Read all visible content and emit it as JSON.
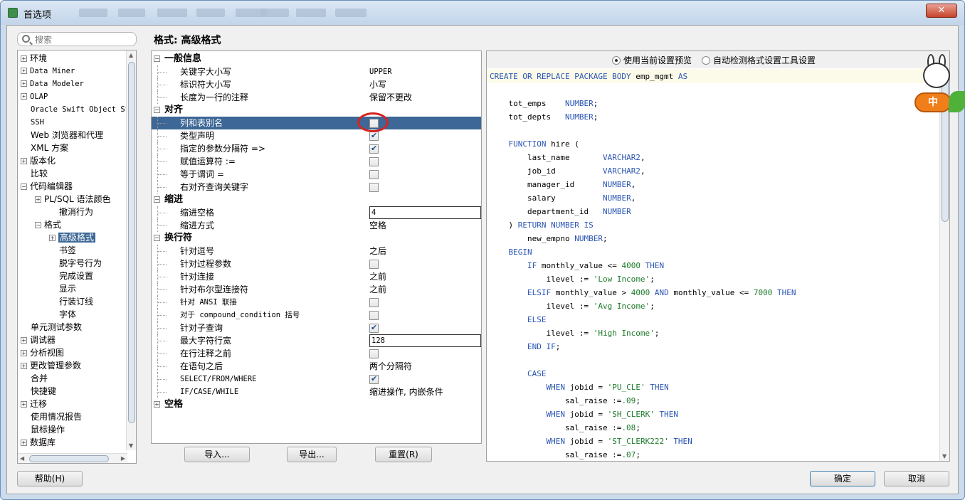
{
  "window": {
    "title": "首选项",
    "close": "✕"
  },
  "search": {
    "placeholder": "搜索"
  },
  "sidebar": {
    "items": [
      {
        "label": "环境",
        "exp": "+"
      },
      {
        "label": "Data Miner",
        "exp": "+",
        "mono": true
      },
      {
        "label": "Data Modeler",
        "exp": "+",
        "mono": true
      },
      {
        "label": "OLAP",
        "exp": "+",
        "mono": true
      },
      {
        "label": "Oracle Swift Object St",
        "mono": true
      },
      {
        "label": "SSH",
        "mono": true
      },
      {
        "label": "Web 浏览器和代理"
      },
      {
        "label": "XML 方案"
      },
      {
        "label": "版本化",
        "exp": "+"
      },
      {
        "label": "比较"
      },
      {
        "label": "代码编辑器",
        "exp": "−"
      },
      {
        "label": "PL/SQL 语法颜色",
        "exp": "+"
      },
      {
        "label": "撤消行为"
      },
      {
        "label": "格式",
        "exp": "−"
      },
      {
        "label": "高级格式",
        "exp": "+",
        "selected": true
      },
      {
        "label": "书签"
      },
      {
        "label": "脱字号行为"
      },
      {
        "label": "完成设置"
      },
      {
        "label": "显示"
      },
      {
        "label": "行装订线"
      },
      {
        "label": "字体"
      },
      {
        "label": "单元测试参数"
      },
      {
        "label": "调试器",
        "exp": "+"
      },
      {
        "label": "分析视图",
        "exp": "+"
      },
      {
        "label": "更改管理参数",
        "exp": "+"
      },
      {
        "label": "合并"
      },
      {
        "label": "快捷键"
      },
      {
        "label": "迁移",
        "exp": "+"
      },
      {
        "label": "使用情况报告"
      },
      {
        "label": "鼠标操作"
      },
      {
        "label": "数据库",
        "exp": "+"
      }
    ]
  },
  "page": {
    "title": "格式: 高级格式"
  },
  "options": {
    "groups": {
      "general": "一般信息",
      "align": "对齐",
      "indent": "缩进",
      "wrap": "换行符",
      "space": "空格"
    },
    "rows": [
      {
        "label": "关键字大小写",
        "value": "UPPER"
      },
      {
        "label": "标识符大小写",
        "value": "小写"
      },
      {
        "label": "长度为一行的注释",
        "value": "保留不更改"
      },
      {
        "label": "列和表别名",
        "checked": false
      },
      {
        "label": "类型声明",
        "checked": true
      },
      {
        "label": "指定的参数分隔符 =>",
        "checked": true
      },
      {
        "label": "赋值运算符 :=",
        "checked": false
      },
      {
        "label": "等于谓词 =",
        "checked": false
      },
      {
        "label": "右对齐查询关键字",
        "checked": false
      },
      {
        "label": "缩进空格",
        "input": "4"
      },
      {
        "label": "缩进方式",
        "value": "空格"
      },
      {
        "label": "针对逗号",
        "value": "之后"
      },
      {
        "label": "针对过程参数",
        "checked": false
      },
      {
        "label": "针对连接",
        "value": "之前"
      },
      {
        "label": "针对布尔型连接符",
        "value": "之前"
      },
      {
        "label": "针对 ANSI 联接",
        "checked": false
      },
      {
        "label": "对于 compound_condition 括号",
        "checked": false
      },
      {
        "label": "针对子查询",
        "checked": true
      },
      {
        "label": "最大字符行宽",
        "input": "128"
      },
      {
        "label": "在行注释之前",
        "checked": false
      },
      {
        "label": "在语句之后",
        "value": "两个分隔符"
      },
      {
        "label": "SELECT/FROM/WHERE",
        "checked": true
      },
      {
        "label": "IF/CASE/WHILE",
        "value": "缩进操作, 内嵌条件"
      }
    ]
  },
  "buttons": {
    "import": "导入...",
    "export": "导出...",
    "reset": "重置(R)",
    "help": "帮助(H)",
    "ok": "确定",
    "cancel": "取消"
  },
  "preview": {
    "radio1": "使用当前设置预览",
    "radio2": "自动检测格式设置工具设置",
    "code": [
      [
        {
          "t": "CREATE OR REPLACE PACKAGE BODY",
          "c": "k"
        },
        {
          "t": " emp_mgmt "
        },
        {
          "t": "AS",
          "c": "k"
        }
      ],
      [],
      [
        {
          "t": "    tot_emps    "
        },
        {
          "t": "NUMBER",
          "c": "k"
        },
        {
          "t": ";"
        }
      ],
      [
        {
          "t": "    tot_depts   "
        },
        {
          "t": "NUMBER",
          "c": "k"
        },
        {
          "t": ";"
        }
      ],
      [],
      [
        {
          "t": "    "
        },
        {
          "t": "FUNCTION",
          "c": "k"
        },
        {
          "t": " hire ("
        }
      ],
      [
        {
          "t": "        last_name       "
        },
        {
          "t": "VARCHAR2",
          "c": "k"
        },
        {
          "t": ","
        }
      ],
      [
        {
          "t": "        job_id          "
        },
        {
          "t": "VARCHAR2",
          "c": "k"
        },
        {
          "t": ","
        }
      ],
      [
        {
          "t": "        manager_id      "
        },
        {
          "t": "NUMBER",
          "c": "k"
        },
        {
          "t": ","
        }
      ],
      [
        {
          "t": "        salary          "
        },
        {
          "t": "NUMBER",
          "c": "k"
        },
        {
          "t": ","
        }
      ],
      [
        {
          "t": "        department_id   "
        },
        {
          "t": "NUMBER",
          "c": "k"
        }
      ],
      [
        {
          "t": "    ) "
        },
        {
          "t": "RETURN NUMBER IS",
          "c": "k"
        }
      ],
      [
        {
          "t": "        new_empno "
        },
        {
          "t": "NUMBER",
          "c": "k"
        },
        {
          "t": ";"
        }
      ],
      [
        {
          "t": "    "
        },
        {
          "t": "BEGIN",
          "c": "k"
        }
      ],
      [
        {
          "t": "        "
        },
        {
          "t": "IF",
          "c": "k"
        },
        {
          "t": " monthly_value <= "
        },
        {
          "t": "4000",
          "c": "s"
        },
        {
          "t": " "
        },
        {
          "t": "THEN",
          "c": "k"
        }
      ],
      [
        {
          "t": "            ilevel := "
        },
        {
          "t": "'Low Income'",
          "c": "s"
        },
        {
          "t": ";"
        }
      ],
      [
        {
          "t": "        "
        },
        {
          "t": "ELSIF",
          "c": "k"
        },
        {
          "t": " monthly_value > "
        },
        {
          "t": "4000",
          "c": "s"
        },
        {
          "t": " "
        },
        {
          "t": "AND",
          "c": "k"
        },
        {
          "t": " monthly_value <= "
        },
        {
          "t": "7000",
          "c": "s"
        },
        {
          "t": " "
        },
        {
          "t": "THEN",
          "c": "k"
        }
      ],
      [
        {
          "t": "            ilevel := "
        },
        {
          "t": "'Avg Income'",
          "c": "s"
        },
        {
          "t": ";"
        }
      ],
      [
        {
          "t": "        "
        },
        {
          "t": "ELSE",
          "c": "k"
        }
      ],
      [
        {
          "t": "            ilevel := "
        },
        {
          "t": "'High Income'",
          "c": "s"
        },
        {
          "t": ";"
        }
      ],
      [
        {
          "t": "        "
        },
        {
          "t": "END IF",
          "c": "k"
        },
        {
          "t": ";"
        }
      ],
      [],
      [
        {
          "t": "        "
        },
        {
          "t": "CASE",
          "c": "k"
        }
      ],
      [
        {
          "t": "            "
        },
        {
          "t": "WHEN",
          "c": "k"
        },
        {
          "t": " jobid = "
        },
        {
          "t": "'PU_CLE'",
          "c": "s"
        },
        {
          "t": " "
        },
        {
          "t": "THEN",
          "c": "k"
        }
      ],
      [
        {
          "t": "                sal_raise :="
        },
        {
          "t": ".09",
          "c": "s"
        },
        {
          "t": ";"
        }
      ],
      [
        {
          "t": "            "
        },
        {
          "t": "WHEN",
          "c": "k"
        },
        {
          "t": " jobid = "
        },
        {
          "t": "'SH_CLERK'",
          "c": "s"
        },
        {
          "t": " "
        },
        {
          "t": "THEN",
          "c": "k"
        }
      ],
      [
        {
          "t": "                sal_raise :="
        },
        {
          "t": ".08",
          "c": "s"
        },
        {
          "t": ";"
        }
      ],
      [
        {
          "t": "            "
        },
        {
          "t": "WHEN",
          "c": "k"
        },
        {
          "t": " jobid = "
        },
        {
          "t": "'ST_CLERK222'",
          "c": "s"
        },
        {
          "t": " "
        },
        {
          "t": "THEN",
          "c": "k"
        }
      ],
      [
        {
          "t": "                sal_raise :="
        },
        {
          "t": ".07",
          "c": "s"
        },
        {
          "t": ";"
        }
      ]
    ]
  },
  "mascot": {
    "badge": "中"
  }
}
